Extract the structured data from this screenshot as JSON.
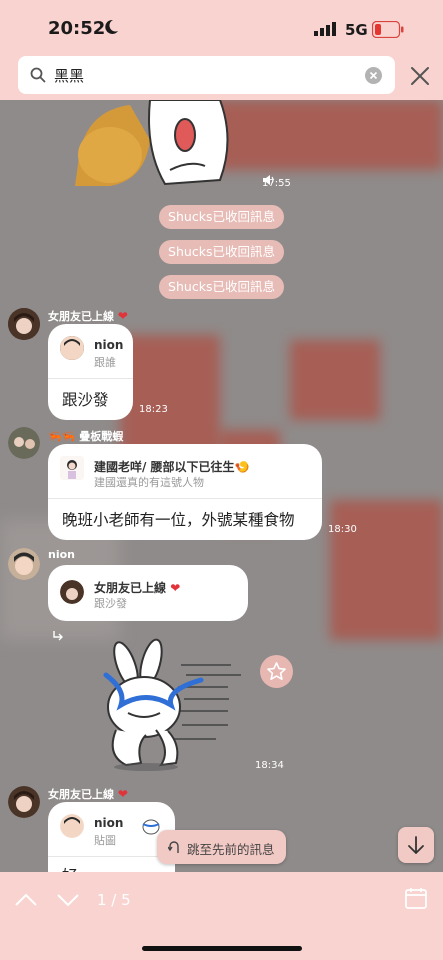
{
  "status_bar": {
    "time": "20:52",
    "network": "5G"
  },
  "search": {
    "query": "黑黑"
  },
  "chat": {
    "sticker_time": "17:55",
    "system_messages": [
      "Shucks已收回訊息",
      "Shucks已收回訊息",
      "Shucks已收回訊息"
    ],
    "messages": [
      {
        "sender": "女朋友已上線",
        "reply_name": "nion",
        "reply_sub": "跟誰",
        "text": "跟沙發",
        "time": "18:23"
      },
      {
        "sender": "疊板戰蝦",
        "reply_name": "建國老咩/ 腰部以下已往生",
        "reply_sub": "建國還真的有這號人物",
        "text": "晚班小老師有一位，外號某種食物",
        "time": "18:30"
      },
      {
        "sender": "nion",
        "reply_name": "女朋友已上線",
        "reply_sub": "跟沙發",
        "sticker_time": "18:34"
      },
      {
        "sender": "女朋友已上線",
        "reply_name": "nion",
        "reply_sub": "貼圖",
        "text": "好"
      }
    ],
    "jump_button": "跳至先前的訊息"
  },
  "bottom_bar": {
    "counter": "1 / 5"
  }
}
